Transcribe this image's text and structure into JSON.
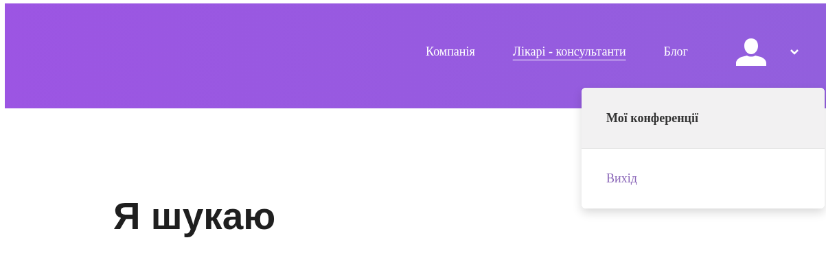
{
  "nav": {
    "items": [
      {
        "label": "Компанія",
        "selected": false
      },
      {
        "label": "Лікарі - консультанти",
        "selected": true
      },
      {
        "label": "Блог",
        "selected": false
      }
    ],
    "user_menu": {
      "expanded": true
    }
  },
  "dropdown": {
    "items": [
      {
        "label": "Мої конференції",
        "highlighted": true
      },
      {
        "label": "Вихід",
        "highlighted": false
      }
    ]
  },
  "heading": "Я шукаю"
}
